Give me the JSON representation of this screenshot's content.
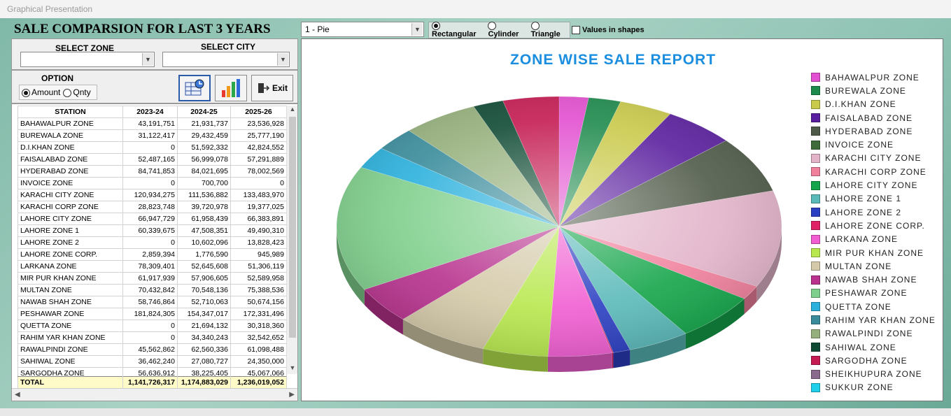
{
  "window": {
    "title": "Graphical Presentation"
  },
  "header": {
    "title": "SALE COMPARSION FOR LAST 3 YEARS"
  },
  "chart_type_select": {
    "value": "1 - Pie"
  },
  "shape_options": [
    {
      "label": "Rectangular",
      "selected": true
    },
    {
      "label": "Cylinder",
      "selected": false
    },
    {
      "label": "Triangle",
      "selected": false
    }
  ],
  "values_in_shapes": {
    "label": "Values in shapes",
    "checked": false
  },
  "filters": {
    "zone_label": "SELECT ZONE",
    "zone_value": "",
    "city_label": "SELECT CITY",
    "city_value": ""
  },
  "option": {
    "label": "OPTION",
    "amount_label": "Amount",
    "qnty_label": "Qnty",
    "selected": "Amount"
  },
  "toolbar": {
    "exit_label": "Exit"
  },
  "colors": {
    "title_blue": "#1b8ee0",
    "total_row": "#fffbc8"
  },
  "table": {
    "columns": [
      "STATION",
      "2023-24",
      "2024-25",
      "2025-26"
    ],
    "rows": [
      [
        "BAHAWALPUR ZONE",
        "43,191,751",
        "21,931,737",
        "23,536,928"
      ],
      [
        "BUREWALA ZONE",
        "31,122,417",
        "29,432,459",
        "25,777,190"
      ],
      [
        "D.I.KHAN ZONE",
        "0",
        "51,592,332",
        "42,824,552"
      ],
      [
        "FAISALABAD ZONE",
        "52,487,165",
        "56,999,078",
        "57,291,889"
      ],
      [
        "HYDERABAD ZONE",
        "84,741,853",
        "84,021,695",
        "78,002,569"
      ],
      [
        "INVOICE ZONE",
        "0",
        "700,700",
        "0"
      ],
      [
        "KARACHI CITY ZONE",
        "120,934,275",
        "111,536,882",
        "133,483,970"
      ],
      [
        "KARACHI CORP ZONE",
        "28,823,748",
        "39,720,978",
        "19,377,025"
      ],
      [
        "LAHORE CITY ZONE",
        "66,947,729",
        "61,958,439",
        "66,383,891"
      ],
      [
        "LAHORE ZONE 1",
        "60,339,675",
        "47,508,351",
        "49,490,310"
      ],
      [
        "LAHORE ZONE 2",
        "0",
        "10,602,096",
        "13,828,423"
      ],
      [
        "LAHORE ZONE CORP.",
        "2,859,394",
        "1,776,590",
        "945,989"
      ],
      [
        "LARKANA ZONE",
        "78,309,401",
        "52,645,608",
        "51,306,119"
      ],
      [
        "MIR PUR KHAN ZONE",
        "61,917,939",
        "57,906,605",
        "52,589,958"
      ],
      [
        "MULTAN ZONE",
        "70,432,842",
        "70,548,136",
        "75,388,536"
      ],
      [
        "NAWAB SHAH ZONE",
        "58,746,864",
        "52,710,063",
        "50,674,156"
      ],
      [
        "PESHAWAR ZONE",
        "181,824,305",
        "154,347,017",
        "172,331,496"
      ],
      [
        "QUETTA ZONE",
        "0",
        "21,694,132",
        "30,318,360"
      ],
      [
        "RAHIM YAR KHAN ZONE",
        "0",
        "34,340,243",
        "32,542,652"
      ],
      [
        "RAWALPINDI ZONE",
        "45,562,862",
        "62,560,336",
        "61,098,488"
      ],
      [
        "SAHIWAL ZONE",
        "36,462,240",
        "27,080,727",
        "24,350,000"
      ],
      [
        "SARGODHA ZONE",
        "56,636,912",
        "38,225,405",
        "45,067,066"
      ]
    ],
    "total": [
      "TOTAL",
      "1,141,726,317",
      "1,174,883,029",
      "1,236,019,052"
    ]
  },
  "chart_data": {
    "type": "pie",
    "title": "ZONE WISE SALE REPORT",
    "legend_position": "right",
    "slices": [
      {
        "name": "BAHAWALPUR ZONE",
        "value": 23536928,
        "color": "#e24fd0"
      },
      {
        "name": "BUREWALA ZONE",
        "value": 25777190,
        "color": "#1e8a4c"
      },
      {
        "name": "D.I.KHAN ZONE",
        "value": 42824552,
        "color": "#c9c94a"
      },
      {
        "name": "FAISALABAD ZONE",
        "value": 57291889,
        "color": "#5a1f9e"
      },
      {
        "name": "HYDERABAD ZONE",
        "value": 78002569,
        "color": "#4f5a48"
      },
      {
        "name": "INVOICE ZONE",
        "value": 0,
        "color": "#3f6b3a"
      },
      {
        "name": "KARACHI CITY ZONE",
        "value": 133483970,
        "color": "#e2b3c9"
      },
      {
        "name": "KARACHI CORP ZONE",
        "value": 19377025,
        "color": "#f07f9c"
      },
      {
        "name": "LAHORE CITY ZONE",
        "value": 66383891,
        "color": "#14a54a"
      },
      {
        "name": "LAHORE ZONE 1",
        "value": 49490310,
        "color": "#5ab9b9"
      },
      {
        "name": "LAHORE ZONE 2",
        "value": 13828423,
        "color": "#2b3fc2"
      },
      {
        "name": "LAHORE ZONE CORP.",
        "value": 945989,
        "color": "#e02065"
      },
      {
        "name": "LARKANA ZONE",
        "value": 51306119,
        "color": "#f05ed2"
      },
      {
        "name": "MIR PUR KHAN ZONE",
        "value": 52589958,
        "color": "#b8e84e"
      },
      {
        "name": "MULTAN ZONE",
        "value": 75388536,
        "color": "#d4c9a8"
      },
      {
        "name": "NAWAB SHAH ZONE",
        "value": 50674156,
        "color": "#b8328e"
      },
      {
        "name": "PESHAWAR ZONE",
        "value": 172331496,
        "color": "#7fcf8c"
      },
      {
        "name": "QUETTA ZONE",
        "value": 30318360,
        "color": "#2ab0dc"
      },
      {
        "name": "RAHIM YAR KHAN ZONE",
        "value": 32542652,
        "color": "#3a8c9c"
      },
      {
        "name": "RAWALPINDI ZONE",
        "value": 61098488,
        "color": "#95b07c"
      },
      {
        "name": "SAHIWAL ZONE",
        "value": 24350000,
        "color": "#0f4a34"
      },
      {
        "name": "SARGODHA ZONE",
        "value": 45067066,
        "color": "#c41b52"
      },
      {
        "name": "SHEIKHUPURA ZONE",
        "value": 0,
        "color": "#8a6a8c"
      },
      {
        "name": "SUKKUR ZONE",
        "value": 0,
        "color": "#1fd0ea"
      }
    ]
  }
}
